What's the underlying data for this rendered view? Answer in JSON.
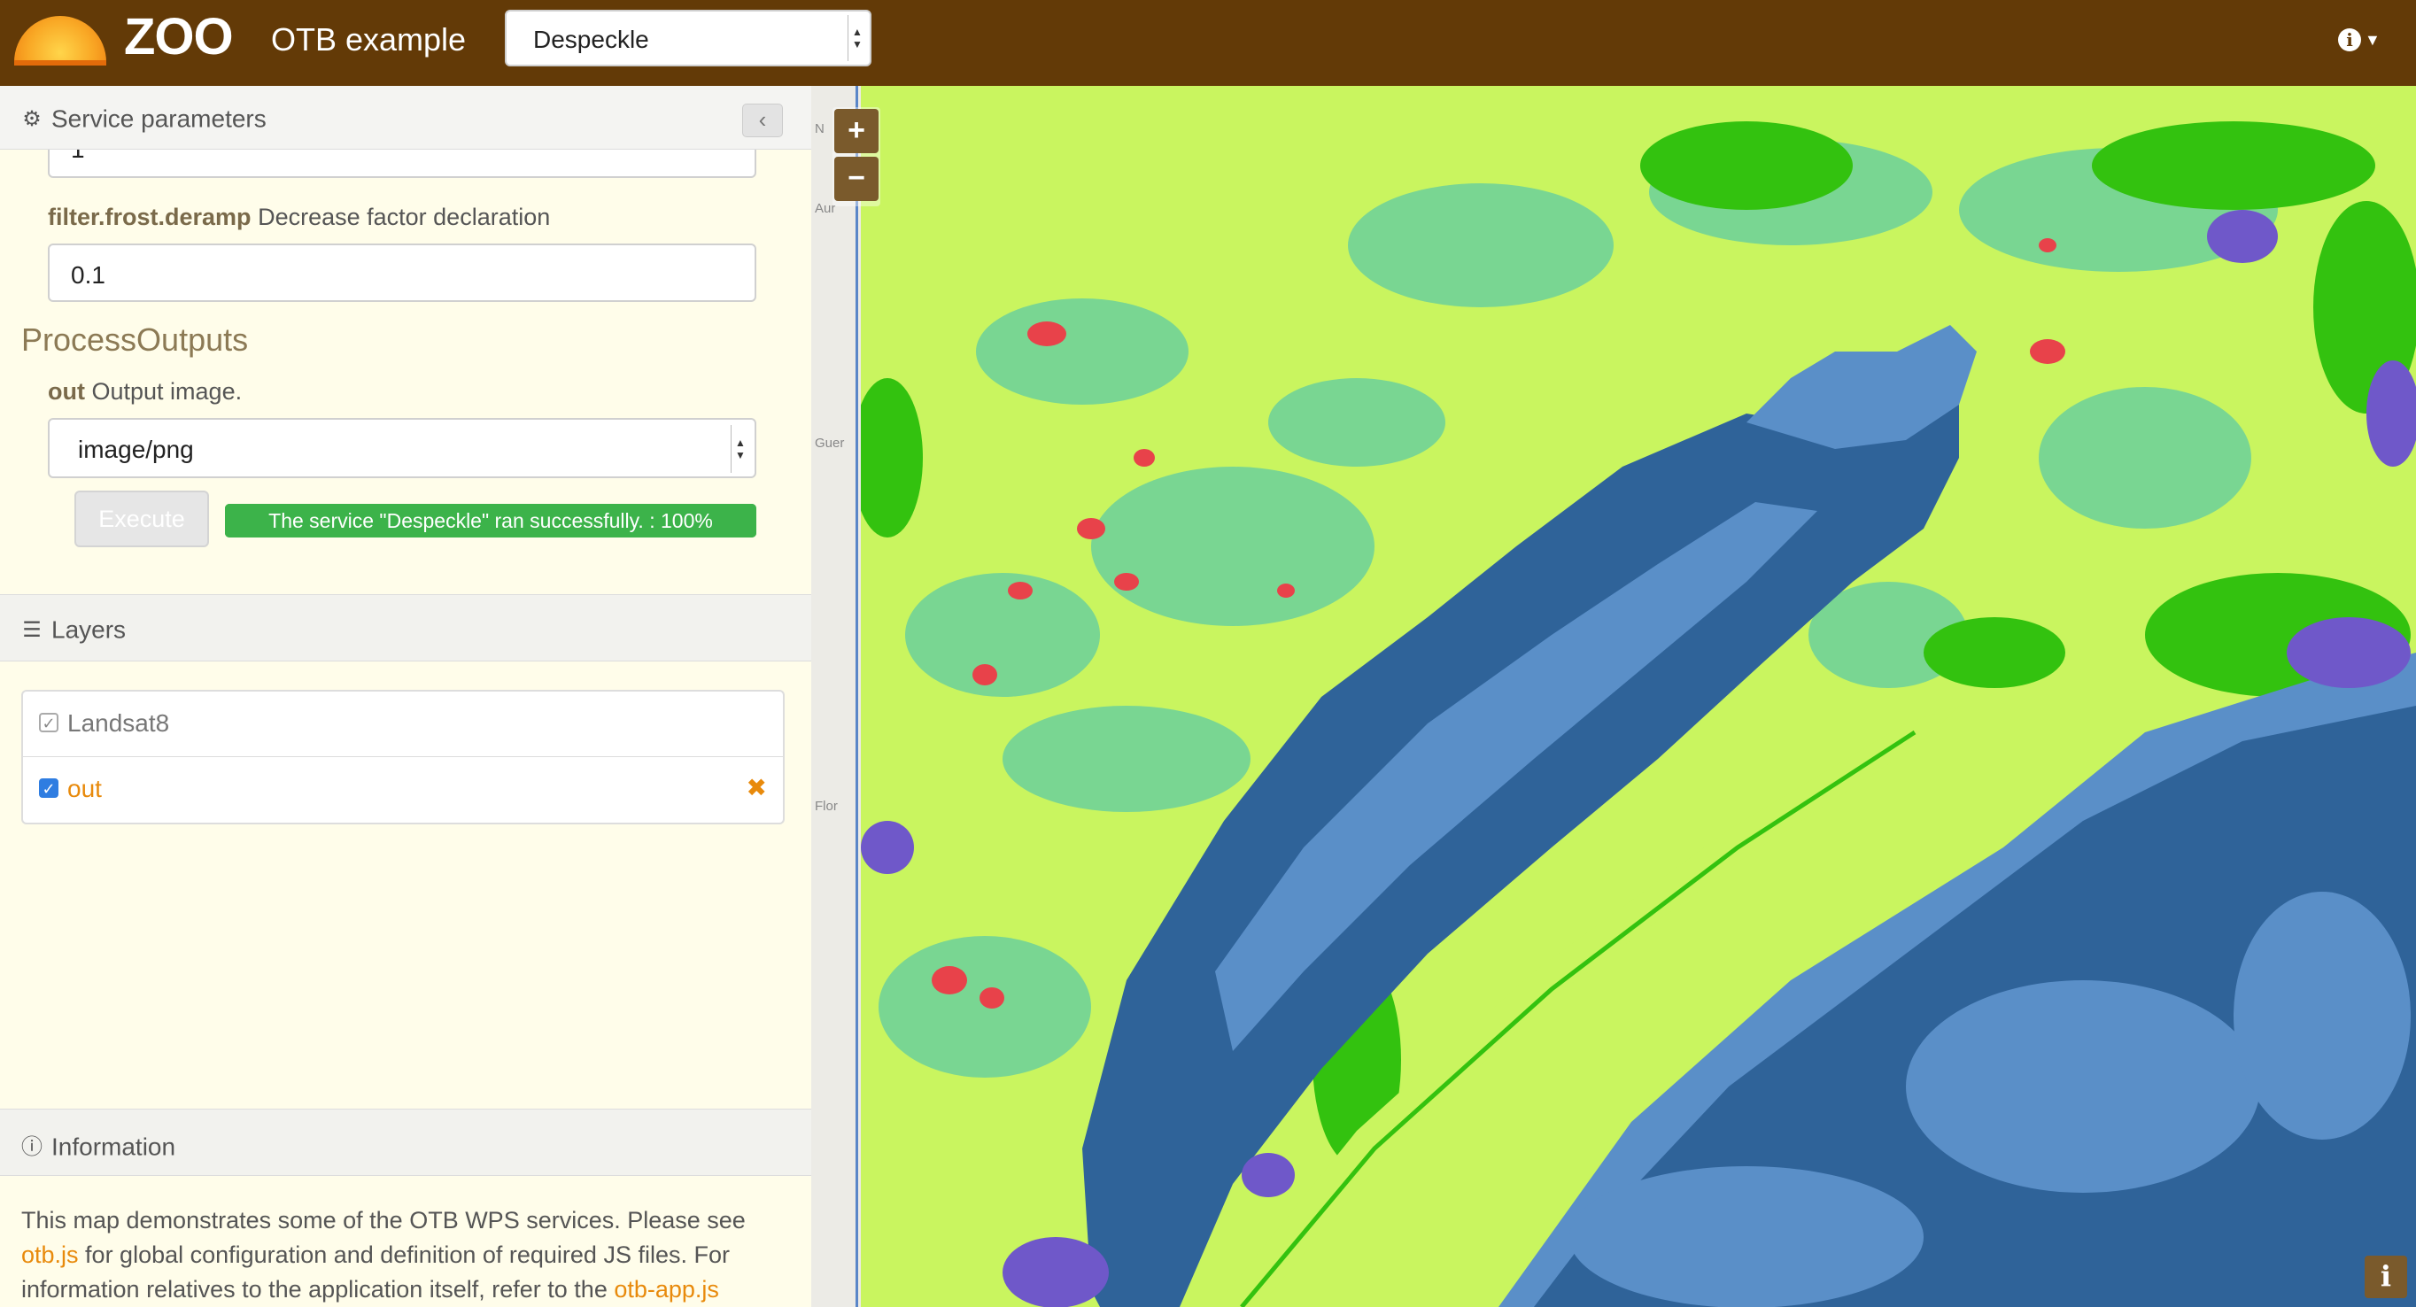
{
  "navbar": {
    "brand": "ZOO",
    "app_title": "OTB example",
    "service_select": {
      "value": "Despeckle",
      "options": [
        "Despeckle"
      ]
    },
    "info_icon": "info-circle-icon"
  },
  "sidebar": {
    "service_parameters": {
      "title": "Service parameters",
      "icon": "gears-icon",
      "collapse_icon": "chevron-left-icon",
      "partial_input_value": "1",
      "deramp_label_name": "filter.frost.deramp",
      "deramp_label_desc": "Decrease factor declaration",
      "deramp_value": "0.1",
      "outputs_title": "ProcessOutputs",
      "out_label_name": "out",
      "out_label_desc": "Output image.",
      "out_format": "image/png",
      "execute_label": "Execute",
      "status_text": "The service \"Despeckle\" ran successfully. : 100%",
      "progress_percent": 100
    },
    "layers": {
      "title": "Layers",
      "icon": "list-icon",
      "items": [
        {
          "name": "Landsat8",
          "checked": true
        },
        {
          "name": "out",
          "checked": true,
          "removable": true
        }
      ]
    },
    "information": {
      "title": "Information",
      "icon": "info-circle-icon",
      "text_1": "This map demonstrates some of the OTB WPS services. Please see ",
      "link_1": "otb.js",
      "text_2": " for global configuration and definition of required JS files. For information relatives to the application itself, refer to the ",
      "link_2": "otb-app.js"
    }
  },
  "map": {
    "zoom_in": "+",
    "zoom_out": "−",
    "attribution": "i",
    "basemap_labels": [
      "N",
      "Aur",
      "Guer",
      "Flor"
    ],
    "colors": {
      "deep_water": "#2f6399",
      "shallow_water": "#5a8fc8",
      "vegetation_light": "#c9f55f",
      "vegetation_mid": "#79d692",
      "vegetation_dark": "#33c20f",
      "urban": "#e8424a",
      "purple": "#6f58c9"
    }
  }
}
